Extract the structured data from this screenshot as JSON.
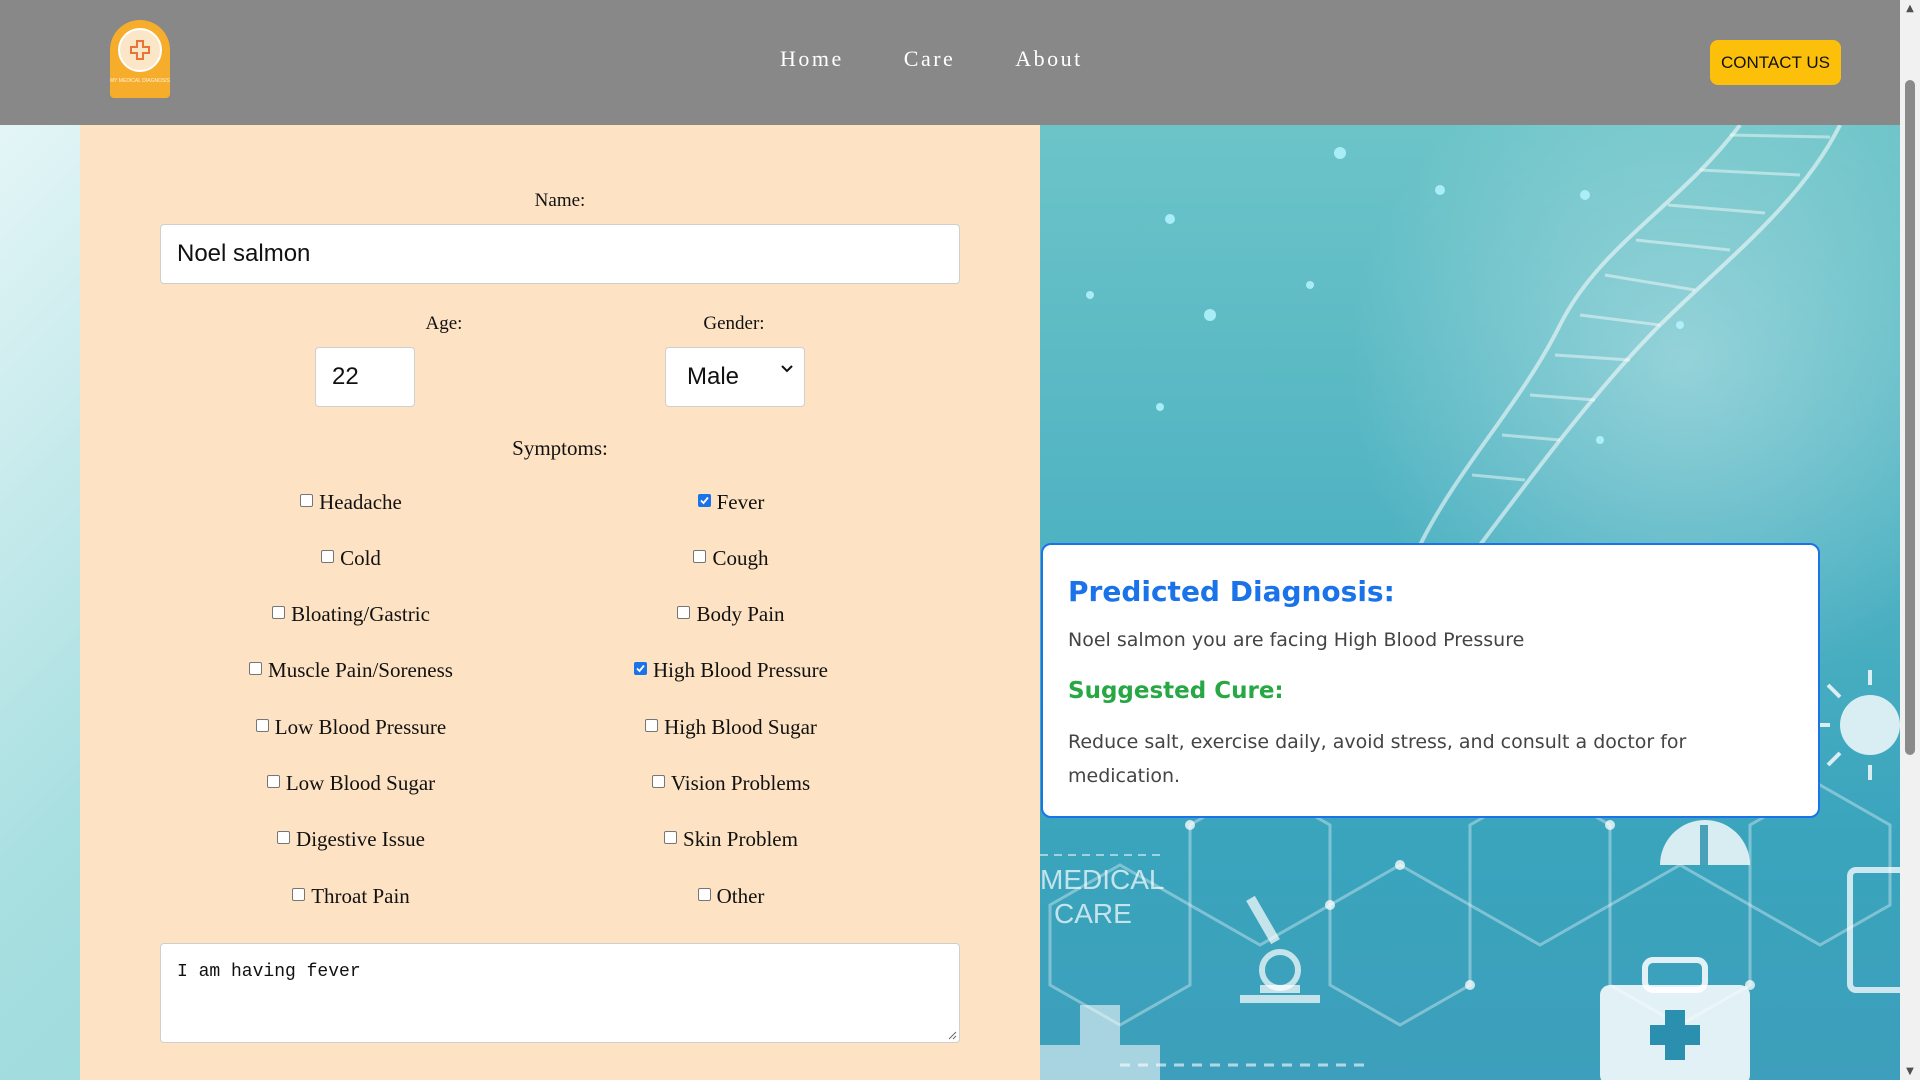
{
  "nav": {
    "logo_text": "MY MEDICAL DIAGNOSIS",
    "links": [
      "Home",
      "Care",
      "About"
    ],
    "contact_label": "CONTACT US"
  },
  "form": {
    "name_label": "Name:",
    "name_value": "Noel salmon",
    "age_label": "Age:",
    "age_value": "22",
    "gender_label": "Gender:",
    "gender_value": "Male",
    "symptoms_label": "Symptoms:",
    "symptoms": [
      {
        "label": "Headache",
        "checked": false
      },
      {
        "label": "Fever",
        "checked": true
      },
      {
        "label": "Cold",
        "checked": false
      },
      {
        "label": "Cough",
        "checked": false
      },
      {
        "label": "Bloating/Gastric",
        "checked": false
      },
      {
        "label": "Body Pain",
        "checked": false
      },
      {
        "label": "Muscle Pain/Soreness",
        "checked": false
      },
      {
        "label": "High Blood Pressure",
        "checked": true
      },
      {
        "label": "Low Blood Pressure",
        "checked": false
      },
      {
        "label": "High Blood Sugar",
        "checked": false
      },
      {
        "label": "Low Blood Sugar",
        "checked": false
      },
      {
        "label": "Vision Problems",
        "checked": false
      },
      {
        "label": "Digestive Issue",
        "checked": false
      },
      {
        "label": "Skin Problem",
        "checked": false
      },
      {
        "label": "Throat Pain",
        "checked": false
      },
      {
        "label": "Other",
        "checked": false
      }
    ],
    "description_value": "I am having fever"
  },
  "result": {
    "diagnosis_title": "Predicted Diagnosis:",
    "diagnosis_text": "Noel salmon you are facing High Blood Pressure",
    "cure_title": "Suggested Cure:",
    "cure_line1": "Reduce salt, exercise daily, avoid stress, and consult a doctor for",
    "cure_line2": "medication."
  },
  "background": {
    "medical_text_line1": "MEDICAL",
    "medical_text_line2": "CARE"
  },
  "colors": {
    "nav_bg": "#888888",
    "accent_yellow": "#fcc00a",
    "form_bg": "#fde3c3",
    "diagnosis_blue": "#1a73e8",
    "cure_green": "#28a745"
  }
}
